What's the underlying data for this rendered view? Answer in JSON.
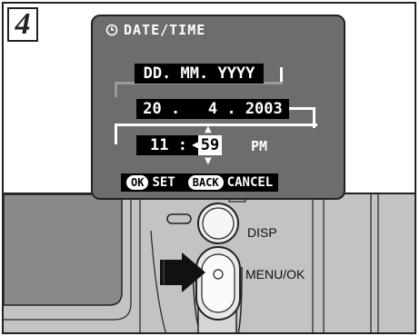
{
  "step": {
    "number": "4"
  },
  "lcd": {
    "title": "DATE/TIME",
    "format_value": "DD. MM. YYYY",
    "date_value": "20 .   4 . 2003",
    "time_hour": "11 :",
    "time_minute": "59",
    "ampm": "PM",
    "ok_label": "OK",
    "set_label": "SET",
    "back_label": "BACK",
    "cancel_label": "CANCEL"
  },
  "camera": {
    "disp_label": "DISP",
    "menu_ok_label": "MENU/OK"
  },
  "colors": {
    "lcd_bg": "#6d6d6d",
    "photo_bg": "#bdbdbd"
  }
}
